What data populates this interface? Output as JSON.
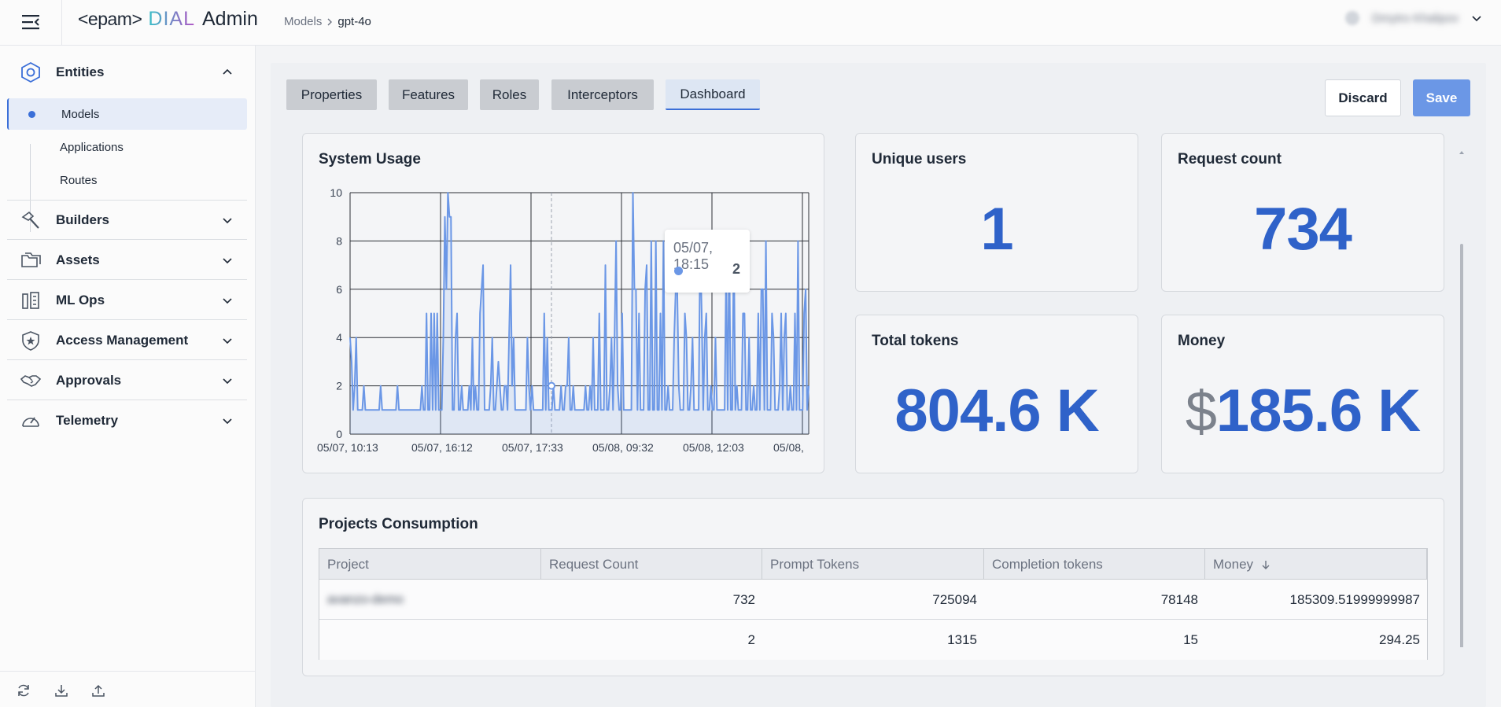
{
  "header": {
    "brand_epam": "<epam>",
    "brand_dial": "DIAL",
    "brand_admin": "Admin",
    "breadcrumb_parent": "Models",
    "breadcrumb_current": "gpt-4o",
    "user_name": "Dmytro Khalipov"
  },
  "sidebar": {
    "groups": [
      {
        "label": "Entities",
        "icon": "hexagon-icon",
        "expanded": true
      },
      {
        "label": "Builders",
        "icon": "hammer-icon"
      },
      {
        "label": "Assets",
        "icon": "folders-icon"
      },
      {
        "label": "ML Ops",
        "icon": "ml-ops-icon"
      },
      {
        "label": "Access Management",
        "icon": "shield-star-icon"
      },
      {
        "label": "Approvals",
        "icon": "handshake-icon"
      },
      {
        "label": "Telemetry",
        "icon": "gauge-icon"
      }
    ],
    "entities_items": [
      {
        "label": "Models",
        "active": true
      },
      {
        "label": "Applications"
      },
      {
        "label": "Routes"
      }
    ]
  },
  "tabs": [
    {
      "label": "Properties"
    },
    {
      "label": "Features"
    },
    {
      "label": "Roles"
    },
    {
      "label": "Interceptors"
    },
    {
      "label": "Dashboard",
      "active": true
    }
  ],
  "actions": {
    "discard": "Discard",
    "save": "Save"
  },
  "stats": {
    "system_usage_title": "System Usage",
    "unique_users_title": "Unique users",
    "unique_users_value": "1",
    "request_count_title": "Request count",
    "request_count_value": "734",
    "total_tokens_title": "Total tokens",
    "total_tokens_value": "804.6 K",
    "money_title": "Money",
    "money_currency": "$",
    "money_value": "185.6 K"
  },
  "tooltip": {
    "date": "05/07, 18:15",
    "value": "2"
  },
  "colors": {
    "accent": "#2f62c9",
    "series": "#6b97e6",
    "save": "#6b97e6"
  },
  "chart_data": {
    "type": "area",
    "title": "System Usage",
    "x_tick_labels": [
      "05/07, 10:13",
      "05/07, 16:12",
      "05/07, 17:33",
      "05/08, 09:32",
      "05/08, 12:03",
      "05/08,"
    ],
    "y_ticks": [
      0,
      2,
      4,
      6,
      8,
      10
    ],
    "ylim": [
      0,
      10
    ],
    "grid": true,
    "series": [
      {
        "values": [
          4,
          3,
          1,
          2,
          4,
          1,
          1,
          1,
          1,
          2,
          1,
          1,
          1,
          1,
          1,
          1,
          1,
          1,
          1,
          1,
          2,
          1,
          1,
          1,
          1,
          1,
          1,
          1,
          1,
          1,
          1,
          2,
          1,
          1,
          1,
          1,
          1,
          1,
          1,
          1,
          1,
          1,
          1,
          1,
          1,
          1,
          1,
          2,
          1,
          1,
          5,
          1,
          1,
          5,
          1,
          5,
          1,
          5,
          1,
          1,
          1,
          4,
          9,
          6,
          10,
          9,
          9,
          1,
          1,
          4,
          5,
          1,
          1,
          2,
          1,
          1,
          1,
          1,
          2,
          1,
          4,
          1,
          2,
          1,
          1,
          5,
          6,
          7,
          1,
          1,
          1,
          1,
          2,
          4,
          1,
          1,
          2,
          3,
          2,
          1,
          1,
          2,
          2,
          1,
          4,
          7,
          2,
          4,
          1,
          1,
          1,
          1,
          1,
          1,
          1,
          1,
          4,
          2,
          1,
          2,
          1,
          1,
          1,
          1,
          1,
          1,
          1,
          5,
          1,
          4,
          1,
          1,
          1,
          2,
          1,
          1,
          1,
          1,
          2,
          1,
          1,
          2,
          2,
          4,
          1,
          1,
          2,
          1,
          1,
          1,
          1,
          1,
          1,
          1,
          2,
          1,
          1,
          2,
          1,
          4,
          1,
          1,
          1,
          5,
          1,
          1,
          1,
          7,
          1,
          1,
          2,
          4,
          1,
          4,
          8,
          2,
          1,
          1,
          5,
          1,
          1,
          1,
          1,
          1,
          1,
          10,
          6,
          6,
          1,
          5,
          1,
          1,
          1,
          6,
          7,
          1,
          1,
          8,
          1,
          1,
          8,
          1,
          1,
          5,
          1,
          8,
          1,
          1,
          2,
          1,
          1,
          1,
          4,
          6,
          6,
          2,
          1,
          1,
          1,
          5,
          4,
          1,
          1,
          2,
          4,
          1,
          1,
          1,
          1,
          8,
          5,
          1,
          4,
          5,
          1,
          1,
          2,
          1,
          1,
          4,
          1,
          1,
          1,
          1,
          1,
          1,
          7,
          1,
          8,
          1,
          1,
          8,
          1,
          2,
          1,
          1,
          1,
          5,
          5,
          1,
          1,
          4,
          1,
          1,
          2,
          1,
          1,
          5,
          1,
          6,
          6,
          1,
          8,
          1,
          1,
          1,
          5,
          4,
          1,
          1,
          1,
          2,
          5,
          1,
          4,
          5,
          1,
          1,
          2,
          1,
          1,
          5,
          1,
          8,
          1,
          1,
          1,
          5,
          6,
          1,
          2
        ]
      }
    ]
  },
  "projects": {
    "title": "Projects Consumption",
    "columns": [
      "Project",
      "Request Count",
      "Prompt Tokens",
      "Completion tokens",
      "Money"
    ],
    "sort_icon": "arrow-down-icon",
    "rows": [
      {
        "project": "avanzo-demo",
        "request_count": "732",
        "prompt_tokens": "725094",
        "completion_tokens": "78148",
        "money": "185309.51999999987"
      },
      {
        "project": "",
        "request_count": "2",
        "prompt_tokens": "1315",
        "completion_tokens": "15",
        "money": "294.25"
      }
    ]
  }
}
